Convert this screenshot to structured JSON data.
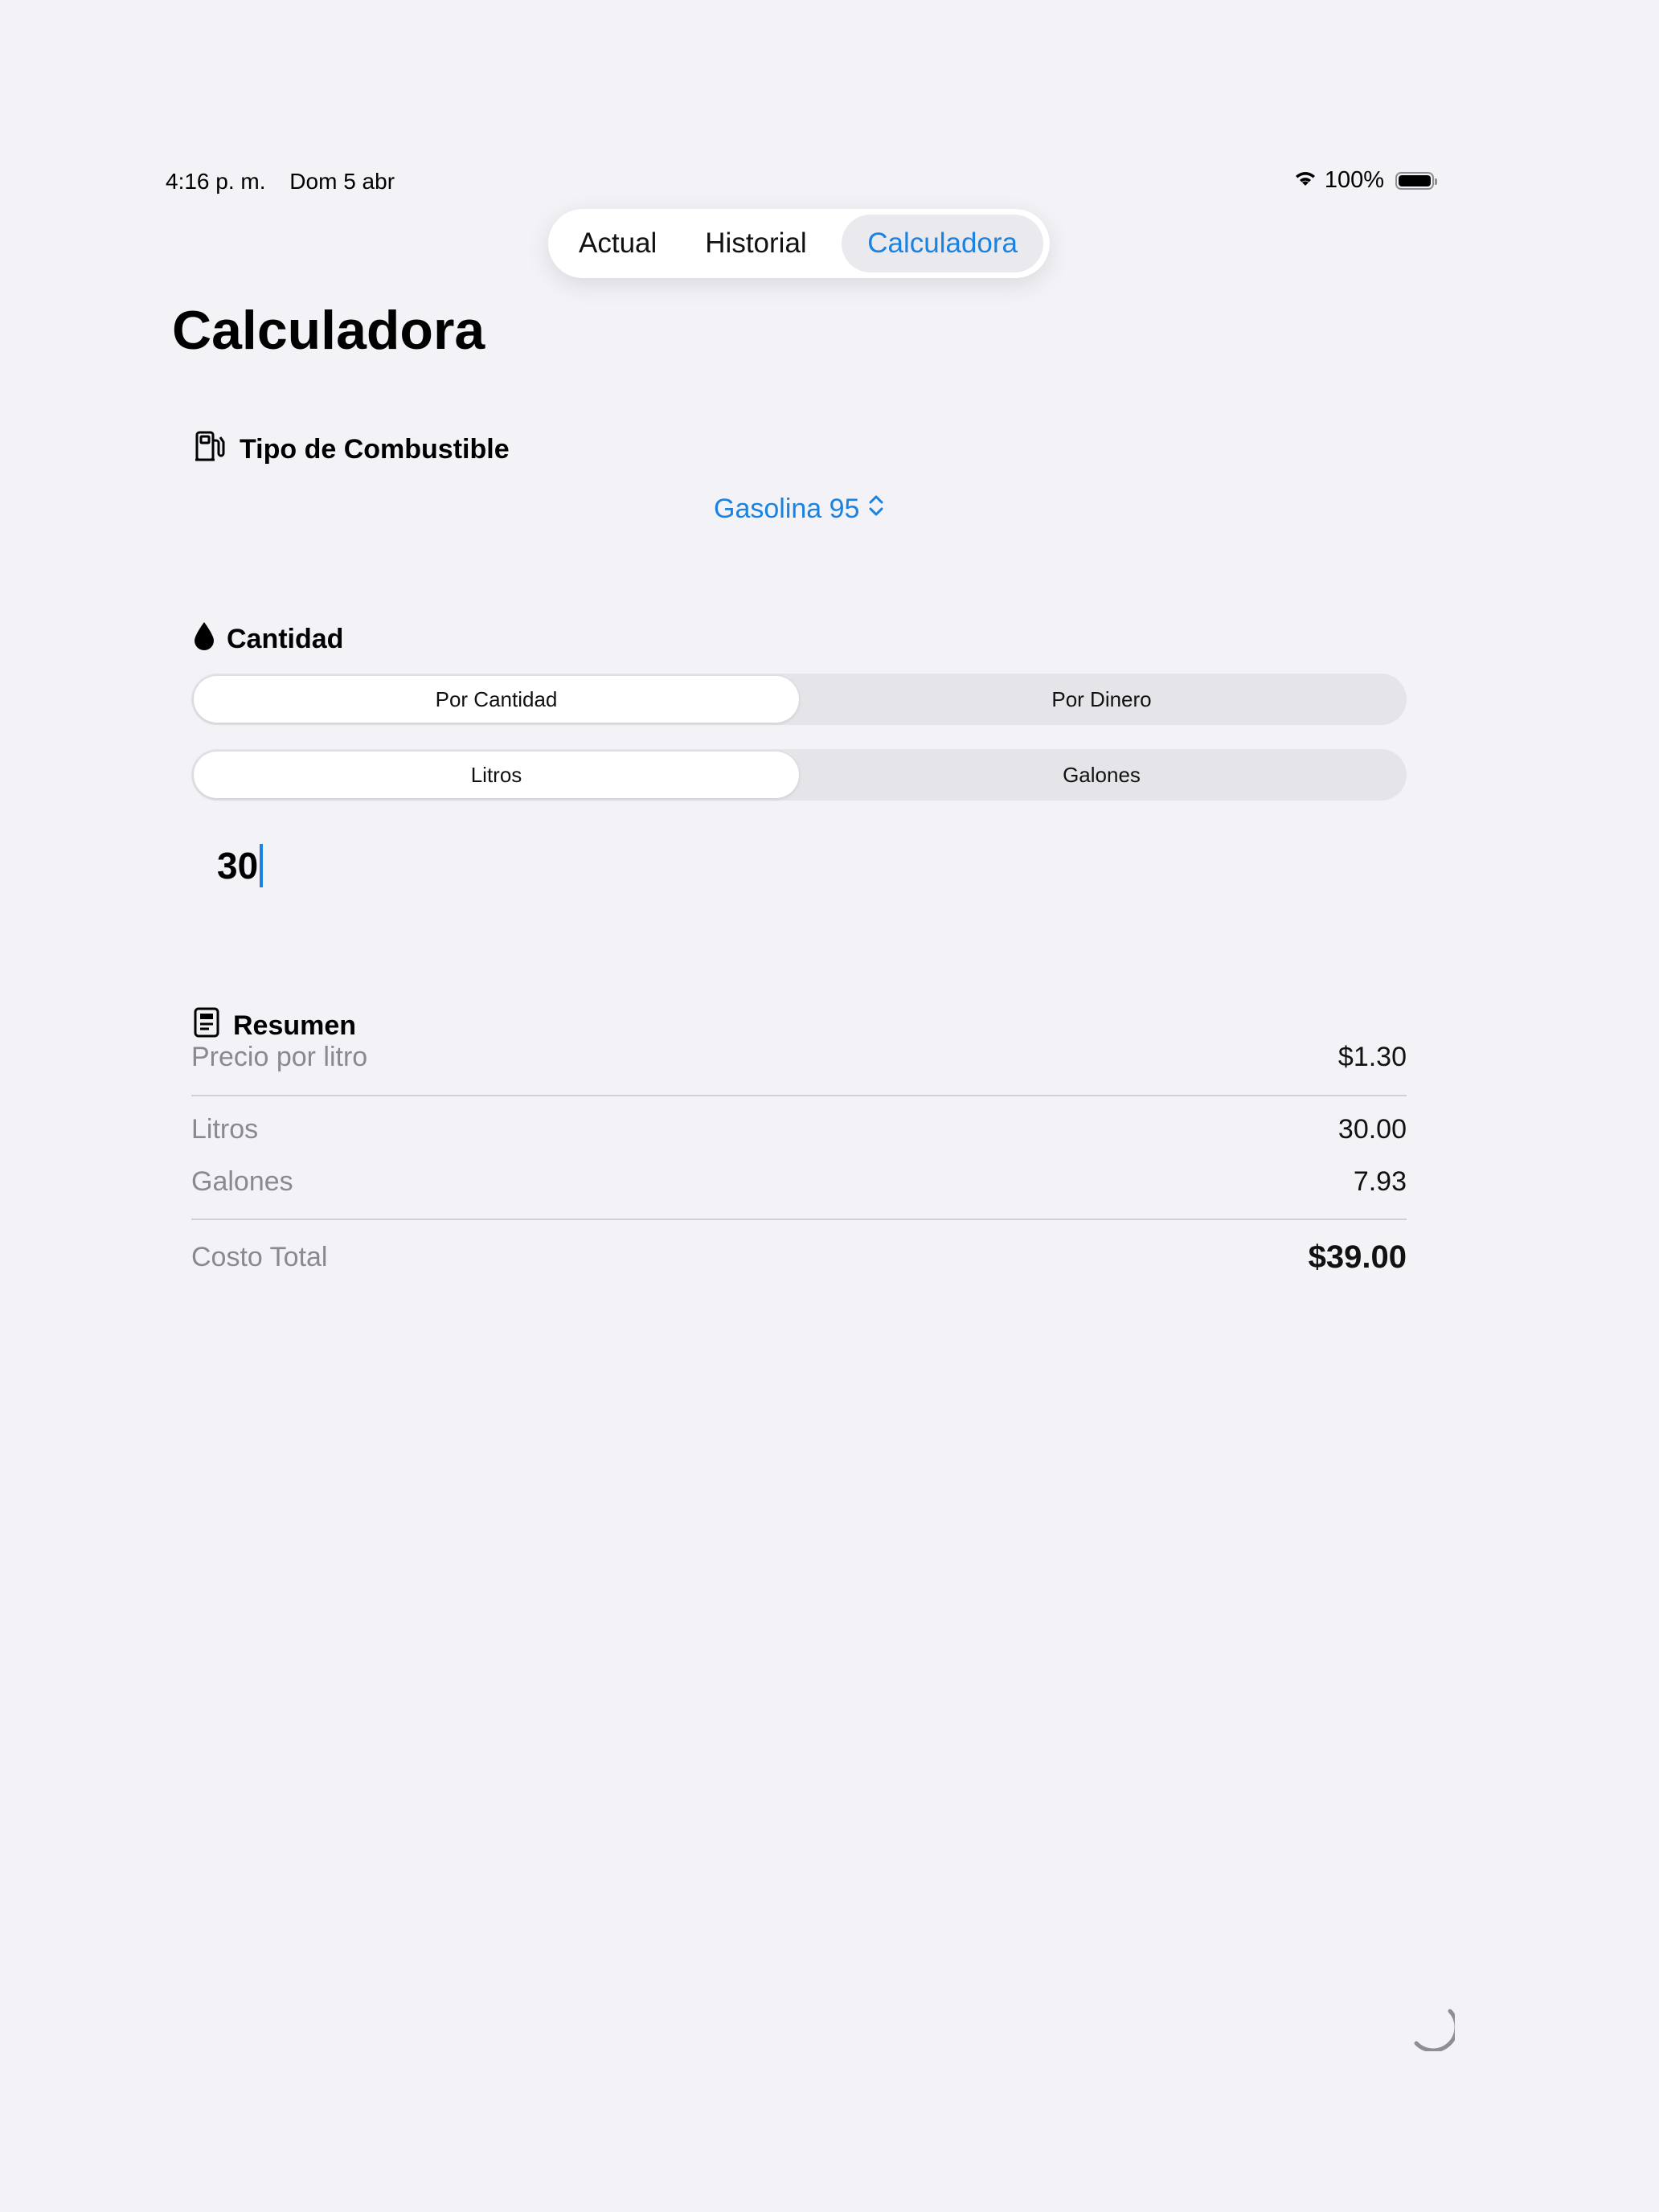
{
  "status_bar": {
    "time": "4:16 p. m.",
    "date": "Dom 5 abr",
    "battery": "100%"
  },
  "tabs": [
    {
      "label": "Actual"
    },
    {
      "label": "Historial"
    },
    {
      "label": "Calculadora",
      "selected": true
    }
  ],
  "page": {
    "title": "Calculadora"
  },
  "fuel": {
    "heading": "Tipo de Combustible",
    "icon": "fuel-pump-icon",
    "selected": "Gasolina 95"
  },
  "quantity": {
    "heading": "Cantidad",
    "icon": "drop-icon",
    "mode_options": [
      "Por Cantidad",
      "Por Dinero"
    ],
    "mode_selected": "Por Cantidad",
    "unit_options": [
      "Litros",
      "Galones"
    ],
    "unit_selected": "Litros",
    "value": "30"
  },
  "summary": {
    "heading": "Resumen",
    "icon": "document-icon",
    "price_label": "Precio por litro",
    "price_value": "$1.30",
    "liters_label": "Litros",
    "liters_value": "30.00",
    "gallons_label": "Galones",
    "gallons_value": "7.93",
    "total_label": "Costo Total",
    "total_value": "$39.00"
  },
  "colors": {
    "accent": "#1a82e0",
    "background": "#f2f2f7"
  }
}
